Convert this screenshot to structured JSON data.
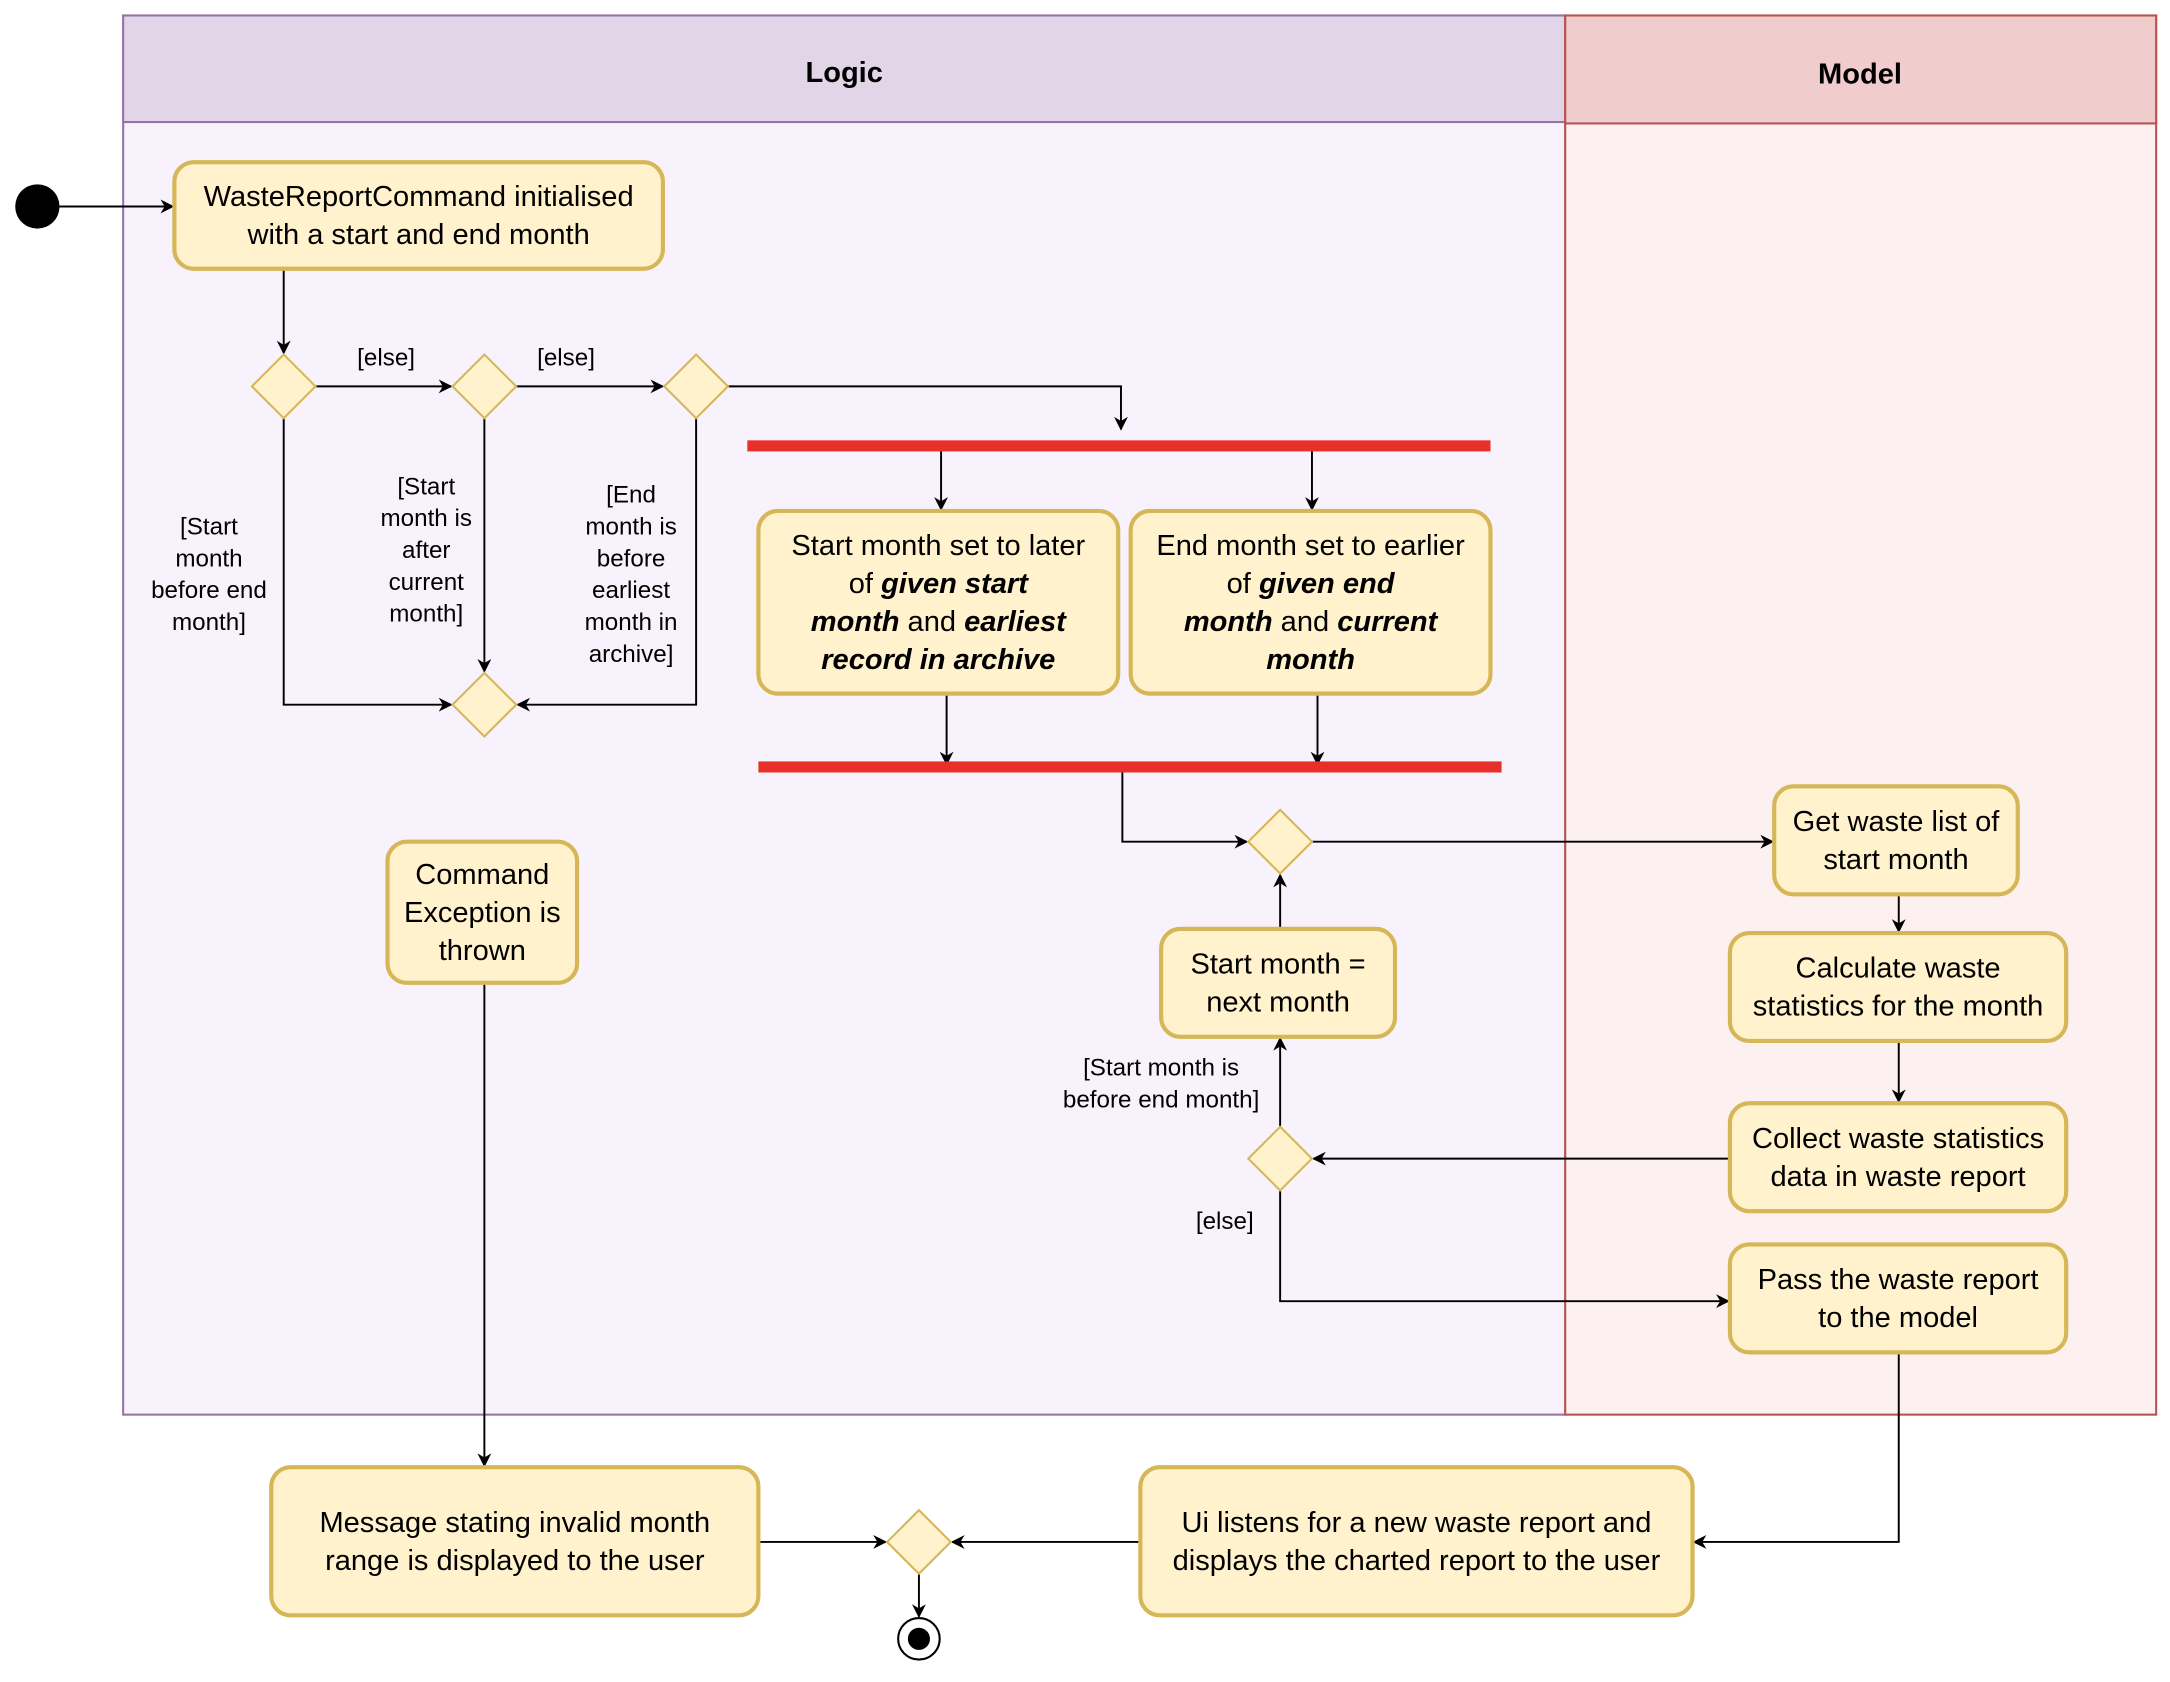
{
  "lanes": {
    "logic": {
      "title": "Logic",
      "header_color": "#e1d5e7",
      "body_color": "#f8f2fc",
      "border_color": "#9673a6"
    },
    "model": {
      "title": "Model",
      "header_color": "#f0cccc",
      "body_color": "#fdf0f0",
      "border_color": "#b85450"
    }
  },
  "colors": {
    "node_fill": "#fff2cc",
    "node_stroke": "#d6b656",
    "sync_bar": "#e8302a"
  },
  "nodes": {
    "init": [
      [
        {
          "t": "WasteReportCommand initialised"
        }
      ],
      [
        {
          "t": "with a start and end month"
        }
      ]
    ],
    "start_later": [
      [
        {
          "t": "Start month set to later"
        }
      ],
      [
        {
          "t": "of "
        },
        {
          "t": "given start",
          "b": true
        }
      ],
      [
        {
          "t": "month",
          "b": true
        },
        {
          "t": " and "
        },
        {
          "t": "earliest",
          "b": true
        }
      ],
      [
        {
          "t": "record in archive",
          "b": true
        }
      ]
    ],
    "end_earlier": [
      [
        {
          "t": "End month set to earlier"
        }
      ],
      [
        {
          "t": "of "
        },
        {
          "t": "given end",
          "b": true
        }
      ],
      [
        {
          "t": "month",
          "b": true
        },
        {
          "t": " and "
        },
        {
          "t": "current",
          "b": true
        }
      ],
      [
        {
          "t": "month",
          "b": true
        }
      ]
    ],
    "exception": [
      [
        {
          "t": "Command"
        }
      ],
      [
        {
          "t": "Exception is"
        }
      ],
      [
        {
          "t": "thrown"
        }
      ]
    ],
    "next_month": [
      [
        {
          "t": "Start month ="
        }
      ],
      [
        {
          "t": "next month"
        }
      ]
    ],
    "get_list": [
      [
        {
          "t": "Get waste list of"
        }
      ],
      [
        {
          "t": "start month"
        }
      ]
    ],
    "calculate": [
      [
        {
          "t": "Calculate waste"
        }
      ],
      [
        {
          "t": "statistics for the month"
        }
      ]
    ],
    "collect": [
      [
        {
          "t": "Collect waste statistics"
        }
      ],
      [
        {
          "t": "data in waste report"
        }
      ]
    ],
    "pass": [
      [
        {
          "t": "Pass the waste report"
        }
      ],
      [
        {
          "t": "to the model"
        }
      ]
    ],
    "message": [
      [
        {
          "t": "Message stating invalid month"
        }
      ],
      [
        {
          "t": "range is displayed to the user"
        }
      ]
    ],
    "ui": [
      [
        {
          "t": "Ui listens for a new waste report and"
        }
      ],
      [
        {
          "t": "displays the charted report to the user"
        }
      ]
    ]
  },
  "guards": {
    "else1": [
      "[else]"
    ],
    "else2": [
      "[else]"
    ],
    "start_before_end": [
      "[Start",
      "month",
      "before end",
      "month]"
    ],
    "start_after_current": [
      "[Start",
      "month is",
      "after",
      "current",
      "month]"
    ],
    "end_before_earliest": [
      "[End",
      "month is",
      "before",
      "earliest",
      "month in",
      "archive]"
    ],
    "loop_start_before_end": [
      "[Start month is",
      "before end month]"
    ],
    "else3": [
      "[else]"
    ]
  }
}
